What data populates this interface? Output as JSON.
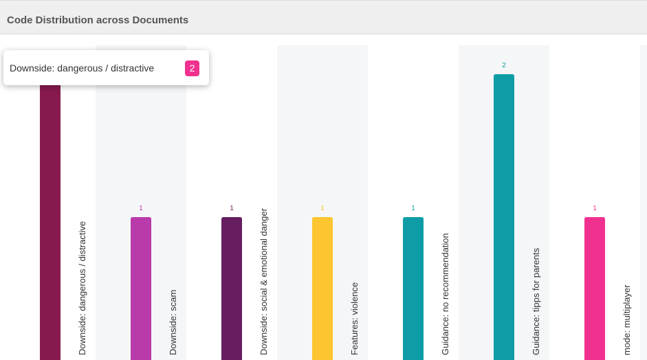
{
  "panel": {
    "title": "Code Distribution across Documents"
  },
  "tooltip": {
    "label": "Downside: dangerous / distractive",
    "value": "2",
    "badge_color": "#f0318f"
  },
  "chart_data": {
    "type": "bar",
    "title": "Code Distribution across Documents",
    "categories": [
      "Downside: dangerous / distractive",
      "Downside: scam",
      "Downside: social & emotional danger",
      "Features: violence",
      "Guidance: no recommendation",
      "Guidance: tipps for parents",
      "mode: multiplayer"
    ],
    "values": [
      2,
      1,
      1,
      1,
      1,
      2,
      1
    ],
    "value_labels": [
      "",
      "1",
      "1",
      "1",
      "1",
      "2",
      "1"
    ],
    "colors": [
      "#861a4e",
      "#b93aab",
      "#661e5f",
      "#fdc52f",
      "#0e9da6",
      "#0e9da6",
      "#f0318f"
    ],
    "ylim": [
      0,
      2
    ],
    "grid": false,
    "legend": "none"
  }
}
